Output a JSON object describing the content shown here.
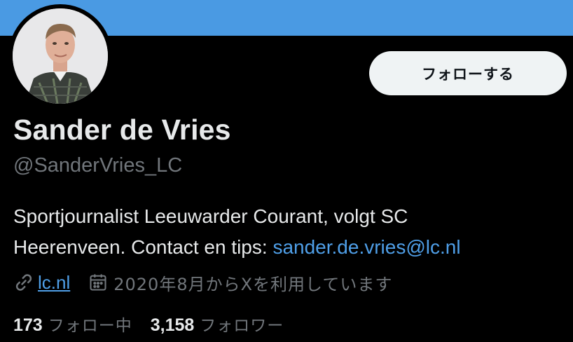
{
  "colors": {
    "banner": "#4a9ae3",
    "background": "#000000",
    "accent_link": "#4f9fe8",
    "secondary_text": "#71767b",
    "button_bg": "#eff3f4"
  },
  "profile": {
    "display_name": "Sander de Vries",
    "handle": "@SanderVries_LC",
    "follow_label": "フォローする",
    "bio_line1": "Sportjournalist Leeuwarder Courant, volgt SC",
    "bio_line2_prefix": "Heerenveen. Contact en tips: ",
    "bio_email": "sander.de.vries@lc.nl",
    "website": "lc.nl",
    "joined": "2020年8月からXを利用しています",
    "icons": {
      "website": "link-icon",
      "joined": "calendar-icon"
    }
  },
  "stats": {
    "following_count": "173",
    "following_label": "フォロー中",
    "followers_count": "3,158",
    "followers_label": "フォロワー"
  }
}
